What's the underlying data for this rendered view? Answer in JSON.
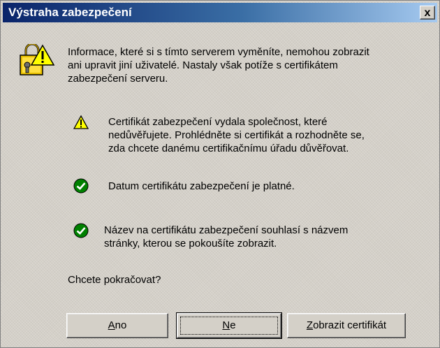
{
  "window": {
    "title": "Výstraha zabezpečení",
    "close_label": "x"
  },
  "main": {
    "intro": "Informace, které si s tímto serverem vyměníte, nemohou zobrazit\nani upravit jiní uživatelé. Nastaly však potíže s certifikátem\nzabezpečení serveru.",
    "items": [
      {
        "status": "warning",
        "text": "Certifikát zabezpečení vydala společnost, které\nnedůvěřujete. Prohlédněte si certifikát a rozhodněte se,\nzda chcete danému certifikačnímu úřadu důvěřovat."
      },
      {
        "status": "ok",
        "text": "Datum certifikátu zabezpečení je platné."
      },
      {
        "status": "ok",
        "text": "Název na certifikátu zabezpečení souhlasí s názvem\nstránky, kterou se pokoušíte zobrazit."
      }
    ],
    "question": "Chcete pokračovat?"
  },
  "buttons": {
    "yes": {
      "label_first": "A",
      "label_rest": "no"
    },
    "no": {
      "label_first": "N",
      "label_rest": "e"
    },
    "view": {
      "label_first": "Z",
      "label_rest": "obrazit certifikát"
    }
  },
  "colors": {
    "title_gradient_start": "#0a246a",
    "title_gradient_end": "#a6caf0",
    "warning_yellow": "#ffff00",
    "ok_green": "#008000",
    "face": "#d4d0c8"
  },
  "icons": {
    "header": "lock-warning-icon",
    "warning": "warning-triangle-icon",
    "ok": "checkmark-circle-icon"
  }
}
